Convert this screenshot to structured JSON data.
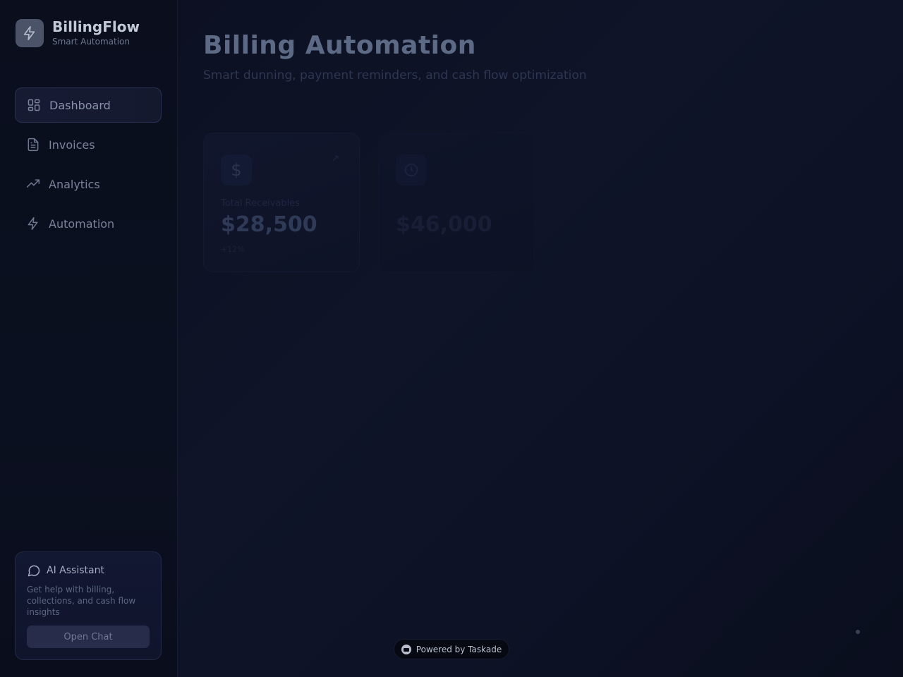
{
  "brand": {
    "name": "BillingFlow",
    "tagline": "Smart Automation",
    "icon": "bolt-icon"
  },
  "nav": {
    "items": [
      {
        "label": "Dashboard",
        "icon": "grid-icon",
        "active": true
      },
      {
        "label": "Invoices",
        "icon": "document-icon",
        "active": false
      },
      {
        "label": "Analytics",
        "icon": "trend-up-icon",
        "active": false
      },
      {
        "label": "Automation",
        "icon": "bolt-icon",
        "active": false
      }
    ]
  },
  "ai_assistant": {
    "title": "AI Assistant",
    "description": "Get help with billing, collections, and cash flow insights",
    "button_label": "Open Chat",
    "icon": "chat-bubble-icon"
  },
  "header": {
    "title": "Billing Automation",
    "subtitle": "Smart dunning, payment reminders, and cash flow optimization"
  },
  "stats": [
    {
      "label": "Total Receivables",
      "value": "$28,500",
      "change": "+12%",
      "icon": "dollar-icon",
      "arrow": "↗"
    },
    {
      "label": "",
      "value": "$46,000",
      "change": "",
      "icon": "clock-icon",
      "arrow": ""
    }
  ],
  "footer": {
    "powered_label": "Powered by Taskade"
  },
  "colors": {
    "background": "#0c1022",
    "accent": "#4a5368"
  }
}
